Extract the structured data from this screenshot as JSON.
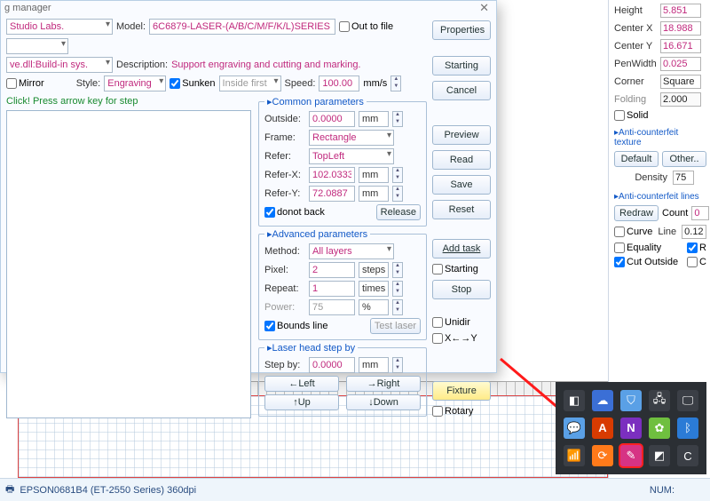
{
  "dialog": {
    "title_fragment": "g manager",
    "row1_combo": "Studio Labs.",
    "model_label": "Model:",
    "model_value": "6C6879-LASER-(A/B/C/M/F/K/L)SERIES",
    "out_to_file": "Out to file",
    "row2_combo": "ve.dll:Build-in sys.",
    "description_label": "Description:",
    "description_value": "Support engraving and cutting and marking.",
    "mirror": "Mirror",
    "style_label": "Style:",
    "style_value": "Engraving",
    "sunken": "Sunken",
    "inside_first": "Inside first",
    "speed_label": "Speed:",
    "speed_value": "100.00",
    "speed_unit": "mm/s",
    "preview_hint": "Click! Press arrow key for step"
  },
  "buttons": {
    "properties": "Properties",
    "starting": "Starting",
    "cancel": "Cancel",
    "preview": "Preview",
    "read": "Read",
    "save": "Save",
    "reset": "Reset",
    "add_task": "Add task",
    "starting_chk": "Starting",
    "stop": "Stop",
    "release": "Release",
    "test_laser": "Test laser",
    "left": "←Left",
    "right": "→Right",
    "up": "↑Up",
    "down": "↓Down",
    "fixture": "Fixture"
  },
  "common": {
    "legend": "Common parameters",
    "outside": "Outside:",
    "outside_val": "0.0000",
    "unit_mm": "mm",
    "frame": "Frame:",
    "frame_val": "Rectangle",
    "refer": "Refer:",
    "refer_val": "TopLeft",
    "referx": "Refer-X:",
    "referx_val": "102.0333",
    "refery": "Refer-Y:",
    "refery_val": "72.0887",
    "donot_back": "donot back"
  },
  "advanced": {
    "legend": "Advanced parameters",
    "method_label": "Method:",
    "method_val": "All layers",
    "pixel_label": "Pixel:",
    "pixel_val": "2",
    "pixel_unit": "steps",
    "repeat_label": "Repeat:",
    "repeat_val": "1",
    "repeat_unit": "times",
    "power_label": "Power:",
    "power_val": "75",
    "power_unit": "%",
    "bounds_line": "Bounds line",
    "unidir": "Unidir",
    "xtoy": "X←→Y"
  },
  "laser": {
    "legend": "Laser head step by",
    "stepby_label": "Step by:",
    "stepby_val": "0.0000",
    "rotary": "Rotary"
  },
  "props": {
    "height": {
      "label": "Height",
      "value": "5.851"
    },
    "centerx": {
      "label": "Center X",
      "value": "18.988"
    },
    "centery": {
      "label": "Center Y",
      "value": "16.671"
    },
    "penwidth": {
      "label": "PenWidth",
      "value": "0.025"
    },
    "corner": {
      "label": "Corner",
      "value": "Square"
    },
    "folding": {
      "label": "Folding",
      "value": "2.000"
    },
    "solid": "Solid",
    "ac_tex": "Anti-counterfeit texture",
    "default_btn": "Default",
    "other_btn": "Other..",
    "density": "Density",
    "density_val": "75",
    "ac_lines": "Anti-counterfeit lines",
    "redraw": "Redraw",
    "count_lbl": "Count",
    "count_val": "0",
    "curve": "Curve",
    "line_lbl": "Line",
    "line_val": "0.12",
    "equality": "Equality",
    "r_opt": "R",
    "cutoutside": "Cut Outside",
    "c_opt": "C"
  },
  "status": {
    "printer_line": "EPSON0681B4 (ET-2550 Series) 360dpi",
    "num": "NUM:"
  }
}
